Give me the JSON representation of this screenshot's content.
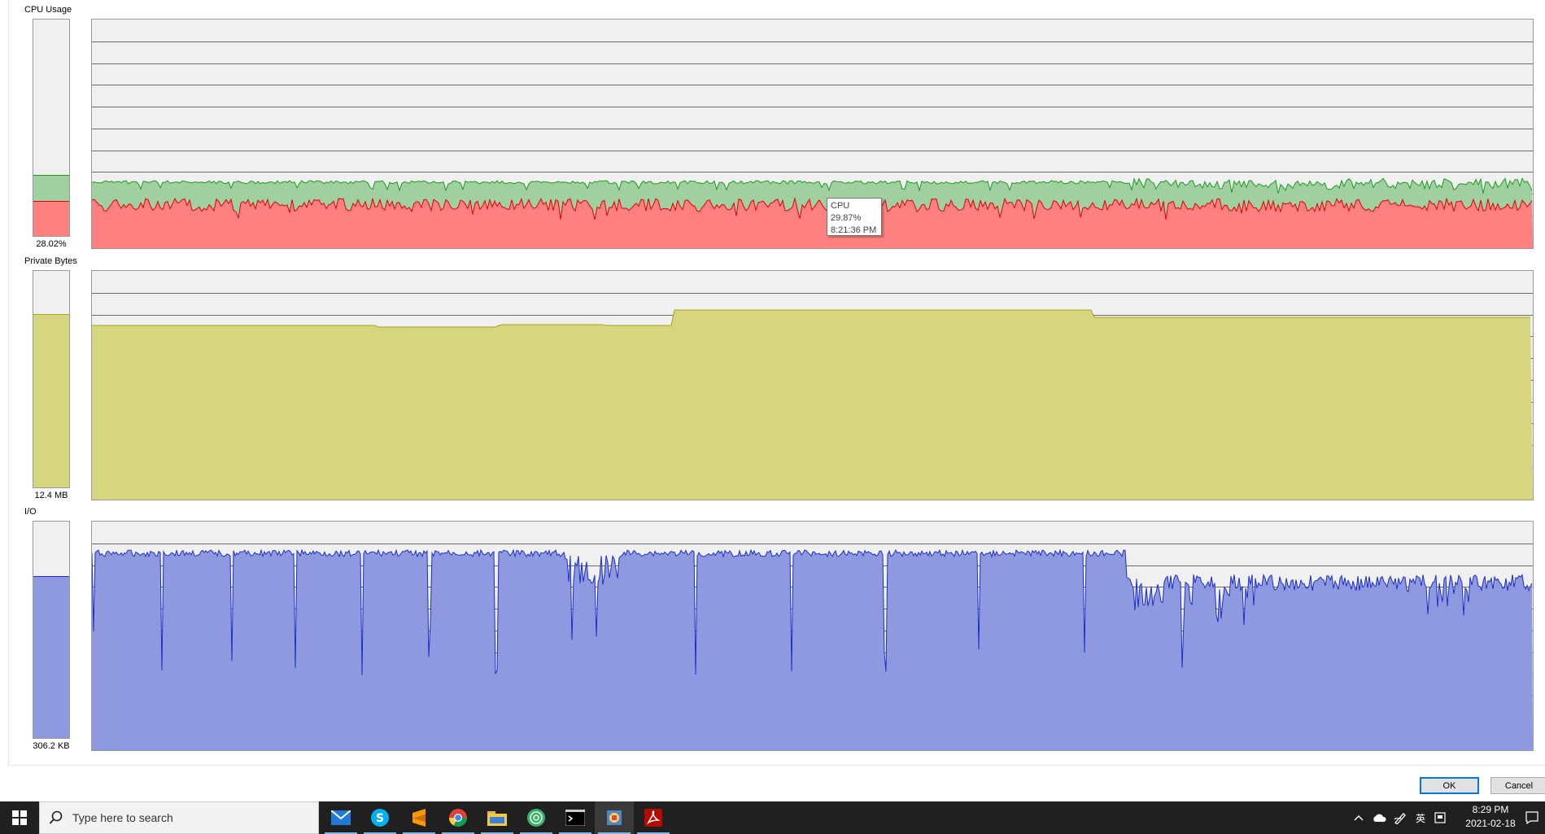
{
  "cpu": {
    "label": "CPU Usage",
    "value": "28.02%",
    "fraction": 0.2802,
    "kernel_fraction": 0.16,
    "colors": {
      "user": "#a0cfa0",
      "user_line": "#1d9a1d",
      "kernel": "#ff8080",
      "kernel_line": "#e00000"
    }
  },
  "private_bytes": {
    "label": "Private Bytes",
    "value": "12.4 MB",
    "fraction": 0.8,
    "colors": {
      "fill": "#d6d67e",
      "line": "#a5a51c"
    }
  },
  "io": {
    "label": "I/O",
    "value": "306.2  KB",
    "fraction": 0.75,
    "colors": {
      "fill": "#8f99e0",
      "line": "#1b2fc4"
    }
  },
  "tooltip": {
    "title": "CPU",
    "value": "29.87%",
    "time": "8:21:36 PM"
  },
  "buttons": {
    "ok": "OK",
    "cancel": "Cancel"
  },
  "taskbar": {
    "search_placeholder": "Type here to search",
    "apps": [
      "mail-icon",
      "skype-icon",
      "sublime-icon",
      "chrome-icon",
      "file-explorer-icon",
      "spiral-app-icon",
      "terminal-icon",
      "process-explorer-icon",
      "acrobat-icon"
    ],
    "ime": "英",
    "time": "8:29 PM",
    "date": "2021-02-18"
  }
}
